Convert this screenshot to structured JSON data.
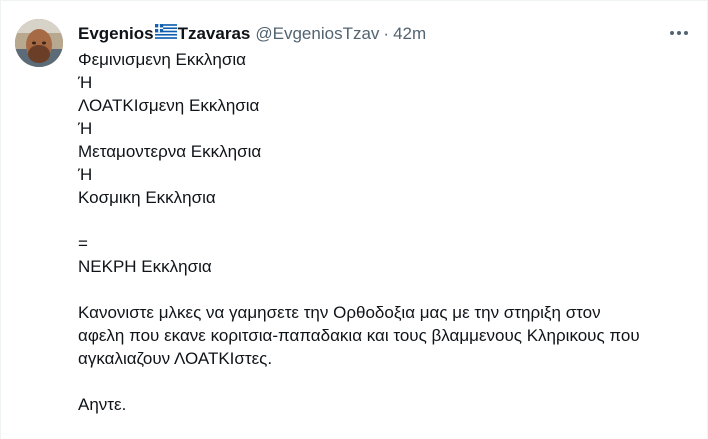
{
  "tweet": {
    "author": {
      "name_part1": "Evgenios",
      "name_part2": "Tzavaras",
      "flag_icon": "greek-flag-icon",
      "handle": "@EvgeniosTzav",
      "separator": "·",
      "time": "42m"
    },
    "avatar_icon": "profile-avatar",
    "more_icon": "more-options-icon",
    "lines": [
      "Φεμινισμενη Εκκλησια",
      "Ή",
      "ΛΟΑΤΚΙσμενη Εκκλησια",
      "Ή",
      "Μεταμοντερνα Εκκλησια",
      "Ή",
      "Κοσμικη Εκκλησια",
      "=",
      "ΝΕΚΡΗ Εκκλησια",
      "Κανονιστε μλκες να γαμησετε την Ορθοδοξια μας με την στηριξη στον",
      "αφελη που εκανε κοριτσια-παπαδακια και τους βλαμμενους Κληρικους που",
      "αγκαλιαζουν ΛΟΑΤΚΙστες.",
      "Αηντε."
    ]
  },
  "colors": {
    "text_primary": "#0f1419",
    "text_secondary": "#536471",
    "flag_blue": "#0d5eaf",
    "flag_white": "#ffffff"
  }
}
